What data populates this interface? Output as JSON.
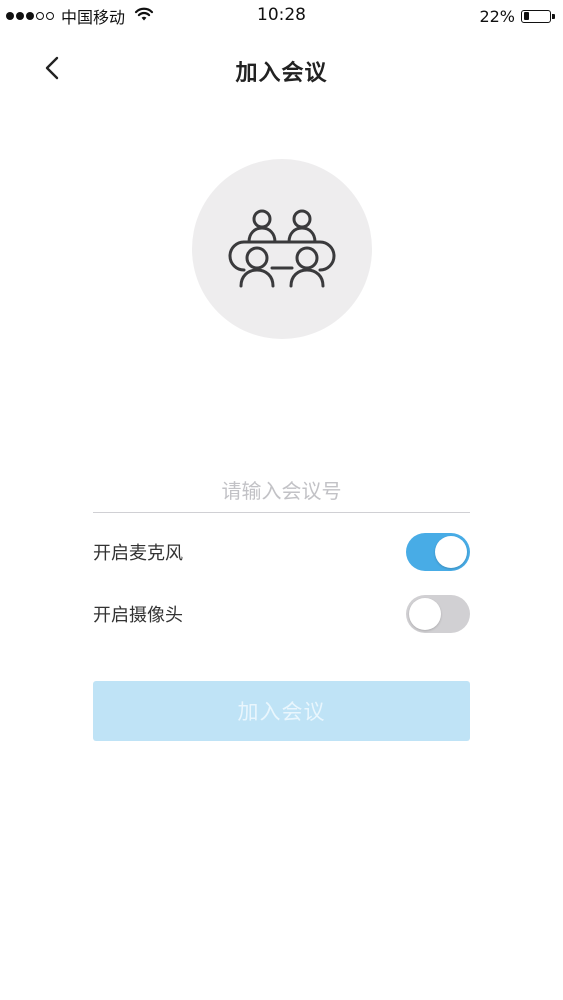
{
  "status_bar": {
    "carrier": "中国移动",
    "time": "10:28",
    "battery_percent_text": "22%",
    "battery_level": 0.22,
    "signal_bars_filled": 3,
    "signal_bars_total": 5
  },
  "nav": {
    "title": "加入会议",
    "back_icon": "chevron-left-icon"
  },
  "illustration": {
    "icon": "meeting-people-icon",
    "background_color": "#eeedee"
  },
  "form": {
    "meeting_id": {
      "placeholder": "请输入会议号",
      "value": ""
    },
    "microphone": {
      "label": "开启麦克风",
      "enabled": true
    },
    "camera": {
      "label": "开启摄像头",
      "enabled": false
    },
    "join_button": {
      "label": "加入会议",
      "disabled": true
    }
  },
  "colors": {
    "toggle_on": "#48ace6",
    "toggle_off": "#d1d0d3",
    "button_disabled_bg": "#bfe3f6",
    "button_disabled_text": "#e9f6fd"
  }
}
